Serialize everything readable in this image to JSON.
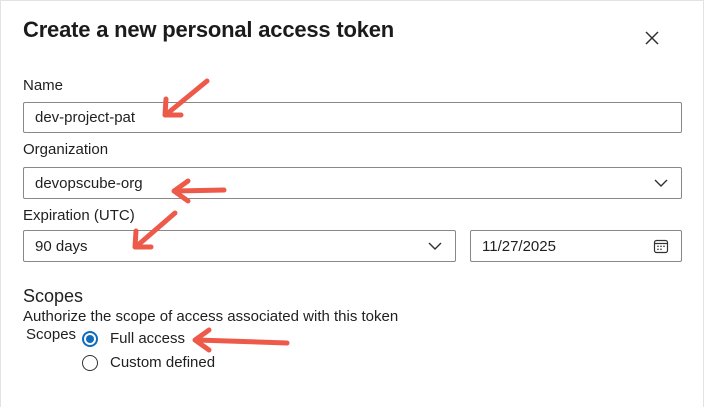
{
  "dialog": {
    "title": "Create a new personal access token"
  },
  "name_field": {
    "label": "Name",
    "value": "dev-project-pat"
  },
  "organization_field": {
    "label": "Organization",
    "selected": "devopscube-org"
  },
  "expiration_field": {
    "label": "Expiration (UTC)",
    "selected": "90 days",
    "date": "11/27/2025"
  },
  "scopes": {
    "heading": "Scopes",
    "description": "Authorize the scope of access associated with this token",
    "label": "Scopes",
    "options": [
      {
        "label": "Full access",
        "checked": true
      },
      {
        "label": "Custom defined",
        "checked": false
      }
    ]
  },
  "colors": {
    "accent": "#0f6cbd",
    "annotation_arrow": "#ee5a4a",
    "border": "#8a8886"
  },
  "icons": {
    "close": "close-icon",
    "dropdown": "chevron-down-icon",
    "calendar": "calendar-icon"
  }
}
